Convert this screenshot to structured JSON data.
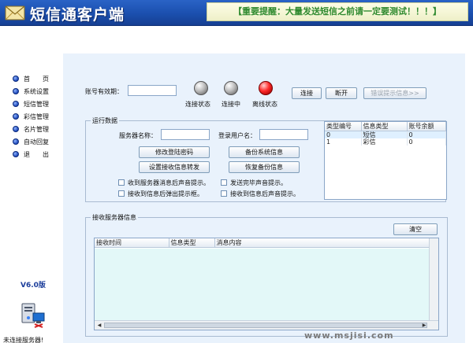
{
  "titlebar": {
    "app_title": "短信通客户端",
    "notice": "【重要提醒：大量发送短信之前请一定要测试！！！】",
    "colors": {
      "bar": "#1b4fae",
      "notice_text": "#2f8a2f"
    }
  },
  "sidebar": {
    "items": [
      {
        "label": "首　　页",
        "icon": "bullet-icon"
      },
      {
        "label": "系统设置",
        "icon": "bullet-icon"
      },
      {
        "label": "短信管理",
        "icon": "bullet-icon"
      },
      {
        "label": "彩信管理",
        "icon": "bullet-icon"
      },
      {
        "label": "名片管理",
        "icon": "bullet-icon"
      },
      {
        "label": "自动回复",
        "icon": "bullet-icon"
      },
      {
        "label": "退　　出",
        "icon": "bullet-icon"
      }
    ],
    "version": "V6.0版",
    "server_icon": "server-network-icon",
    "server_status": "未连接服务器!"
  },
  "account": {
    "validity_label": "账号有效期：",
    "validity_value": ""
  },
  "status_lights": [
    {
      "label": "连接状态",
      "color": "gray"
    },
    {
      "label": "连接中",
      "color": "gray"
    },
    {
      "label": "离线状态",
      "color": "red"
    }
  ],
  "buttons": {
    "connect": "连接",
    "disconnect": "断开",
    "error_info": "错误提示信息>>"
  },
  "runtime": {
    "title": "运行数据",
    "server_name_label": "服务器名称：",
    "server_name_value": "",
    "login_user_label": "登录用户名：",
    "login_user_value": "",
    "change_password": "修改登陆密码",
    "backup_system": "备份系统信息",
    "set_forward": "设置接收信息转发",
    "restore_backup": "恢复备份信息",
    "checkboxes": [
      {
        "label": "收到服务器消息后声音提示。",
        "checked": false
      },
      {
        "label": "发送完毕声音提示。",
        "checked": false
      },
      {
        "label": "接收到信息后弹出提示框。",
        "checked": false
      },
      {
        "label": "接收到信息后声音提示。",
        "checked": false
      }
    ],
    "type_table": {
      "columns": [
        "类型编号",
        "信息类型",
        "账号余额"
      ],
      "rows": [
        [
          "0",
          "短信",
          "0"
        ],
        [
          "1",
          "彩信",
          "0"
        ]
      ]
    }
  },
  "receive": {
    "title": "接收服务器信息",
    "clear": "清空",
    "columns": [
      "接收时间",
      "信息类型",
      "消息内容"
    ],
    "rows": []
  },
  "watermark": "www.msjisi.com"
}
